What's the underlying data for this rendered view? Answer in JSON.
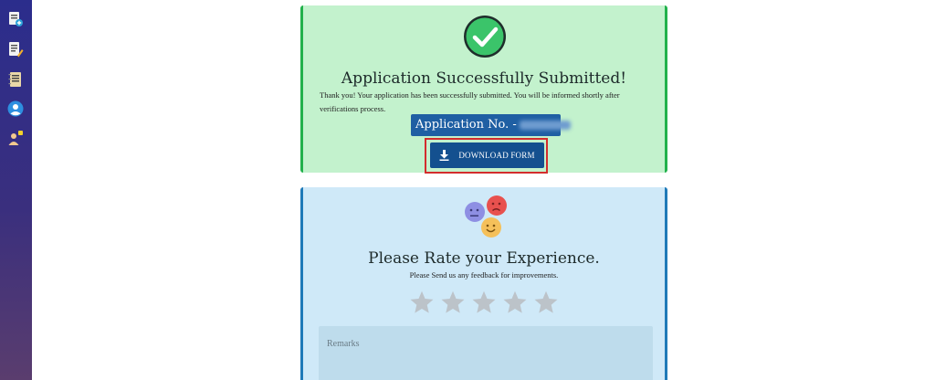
{
  "sidebar": {
    "items": [
      {
        "icon": "document-add-icon"
      },
      {
        "icon": "document-edit-icon"
      },
      {
        "icon": "notebook-icon"
      },
      {
        "icon": "user-profile-icon"
      },
      {
        "icon": "user-key-icon"
      }
    ]
  },
  "success": {
    "title": "Application Successfully Submitted!",
    "message": "Thank you! Your application has been successfully submitted. You will be informed shortly after verifications process.",
    "application_label": "Application No. -",
    "download_label": "DOWNLOAD FORM",
    "accent": "#22b14c"
  },
  "feedback": {
    "title": "Please Rate your Experience.",
    "subtitle": "Please Send us any feedback for improvements.",
    "rating": 0,
    "max_rating": 5,
    "remarks_placeholder": "Remarks",
    "accent": "#1f7ab8"
  }
}
